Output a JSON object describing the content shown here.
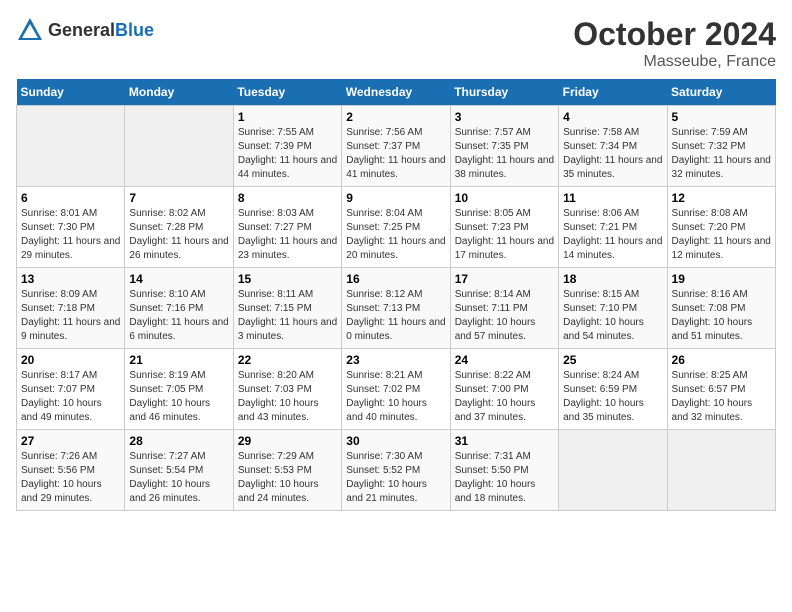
{
  "header": {
    "logo_general": "General",
    "logo_blue": "Blue",
    "month": "October 2024",
    "location": "Masseube, France"
  },
  "weekdays": [
    "Sunday",
    "Monday",
    "Tuesday",
    "Wednesday",
    "Thursday",
    "Friday",
    "Saturday"
  ],
  "weeks": [
    [
      {
        "day": "",
        "sunrise": "",
        "sunset": "",
        "daylight": ""
      },
      {
        "day": "",
        "sunrise": "",
        "sunset": "",
        "daylight": ""
      },
      {
        "day": "1",
        "sunrise": "Sunrise: 7:55 AM",
        "sunset": "Sunset: 7:39 PM",
        "daylight": "Daylight: 11 hours and 44 minutes."
      },
      {
        "day": "2",
        "sunrise": "Sunrise: 7:56 AM",
        "sunset": "Sunset: 7:37 PM",
        "daylight": "Daylight: 11 hours and 41 minutes."
      },
      {
        "day": "3",
        "sunrise": "Sunrise: 7:57 AM",
        "sunset": "Sunset: 7:35 PM",
        "daylight": "Daylight: 11 hours and 38 minutes."
      },
      {
        "day": "4",
        "sunrise": "Sunrise: 7:58 AM",
        "sunset": "Sunset: 7:34 PM",
        "daylight": "Daylight: 11 hours and 35 minutes."
      },
      {
        "day": "5",
        "sunrise": "Sunrise: 7:59 AM",
        "sunset": "Sunset: 7:32 PM",
        "daylight": "Daylight: 11 hours and 32 minutes."
      }
    ],
    [
      {
        "day": "6",
        "sunrise": "Sunrise: 8:01 AM",
        "sunset": "Sunset: 7:30 PM",
        "daylight": "Daylight: 11 hours and 29 minutes."
      },
      {
        "day": "7",
        "sunrise": "Sunrise: 8:02 AM",
        "sunset": "Sunset: 7:28 PM",
        "daylight": "Daylight: 11 hours and 26 minutes."
      },
      {
        "day": "8",
        "sunrise": "Sunrise: 8:03 AM",
        "sunset": "Sunset: 7:27 PM",
        "daylight": "Daylight: 11 hours and 23 minutes."
      },
      {
        "day": "9",
        "sunrise": "Sunrise: 8:04 AM",
        "sunset": "Sunset: 7:25 PM",
        "daylight": "Daylight: 11 hours and 20 minutes."
      },
      {
        "day": "10",
        "sunrise": "Sunrise: 8:05 AM",
        "sunset": "Sunset: 7:23 PM",
        "daylight": "Daylight: 11 hours and 17 minutes."
      },
      {
        "day": "11",
        "sunrise": "Sunrise: 8:06 AM",
        "sunset": "Sunset: 7:21 PM",
        "daylight": "Daylight: 11 hours and 14 minutes."
      },
      {
        "day": "12",
        "sunrise": "Sunrise: 8:08 AM",
        "sunset": "Sunset: 7:20 PM",
        "daylight": "Daylight: 11 hours and 12 minutes."
      }
    ],
    [
      {
        "day": "13",
        "sunrise": "Sunrise: 8:09 AM",
        "sunset": "Sunset: 7:18 PM",
        "daylight": "Daylight: 11 hours and 9 minutes."
      },
      {
        "day": "14",
        "sunrise": "Sunrise: 8:10 AM",
        "sunset": "Sunset: 7:16 PM",
        "daylight": "Daylight: 11 hours and 6 minutes."
      },
      {
        "day": "15",
        "sunrise": "Sunrise: 8:11 AM",
        "sunset": "Sunset: 7:15 PM",
        "daylight": "Daylight: 11 hours and 3 minutes."
      },
      {
        "day": "16",
        "sunrise": "Sunrise: 8:12 AM",
        "sunset": "Sunset: 7:13 PM",
        "daylight": "Daylight: 11 hours and 0 minutes."
      },
      {
        "day": "17",
        "sunrise": "Sunrise: 8:14 AM",
        "sunset": "Sunset: 7:11 PM",
        "daylight": "Daylight: 10 hours and 57 minutes."
      },
      {
        "day": "18",
        "sunrise": "Sunrise: 8:15 AM",
        "sunset": "Sunset: 7:10 PM",
        "daylight": "Daylight: 10 hours and 54 minutes."
      },
      {
        "day": "19",
        "sunrise": "Sunrise: 8:16 AM",
        "sunset": "Sunset: 7:08 PM",
        "daylight": "Daylight: 10 hours and 51 minutes."
      }
    ],
    [
      {
        "day": "20",
        "sunrise": "Sunrise: 8:17 AM",
        "sunset": "Sunset: 7:07 PM",
        "daylight": "Daylight: 10 hours and 49 minutes."
      },
      {
        "day": "21",
        "sunrise": "Sunrise: 8:19 AM",
        "sunset": "Sunset: 7:05 PM",
        "daylight": "Daylight: 10 hours and 46 minutes."
      },
      {
        "day": "22",
        "sunrise": "Sunrise: 8:20 AM",
        "sunset": "Sunset: 7:03 PM",
        "daylight": "Daylight: 10 hours and 43 minutes."
      },
      {
        "day": "23",
        "sunrise": "Sunrise: 8:21 AM",
        "sunset": "Sunset: 7:02 PM",
        "daylight": "Daylight: 10 hours and 40 minutes."
      },
      {
        "day": "24",
        "sunrise": "Sunrise: 8:22 AM",
        "sunset": "Sunset: 7:00 PM",
        "daylight": "Daylight: 10 hours and 37 minutes."
      },
      {
        "day": "25",
        "sunrise": "Sunrise: 8:24 AM",
        "sunset": "Sunset: 6:59 PM",
        "daylight": "Daylight: 10 hours and 35 minutes."
      },
      {
        "day": "26",
        "sunrise": "Sunrise: 8:25 AM",
        "sunset": "Sunset: 6:57 PM",
        "daylight": "Daylight: 10 hours and 32 minutes."
      }
    ],
    [
      {
        "day": "27",
        "sunrise": "Sunrise: 7:26 AM",
        "sunset": "Sunset: 5:56 PM",
        "daylight": "Daylight: 10 hours and 29 minutes."
      },
      {
        "day": "28",
        "sunrise": "Sunrise: 7:27 AM",
        "sunset": "Sunset: 5:54 PM",
        "daylight": "Daylight: 10 hours and 26 minutes."
      },
      {
        "day": "29",
        "sunrise": "Sunrise: 7:29 AM",
        "sunset": "Sunset: 5:53 PM",
        "daylight": "Daylight: 10 hours and 24 minutes."
      },
      {
        "day": "30",
        "sunrise": "Sunrise: 7:30 AM",
        "sunset": "Sunset: 5:52 PM",
        "daylight": "Daylight: 10 hours and 21 minutes."
      },
      {
        "day": "31",
        "sunrise": "Sunrise: 7:31 AM",
        "sunset": "Sunset: 5:50 PM",
        "daylight": "Daylight: 10 hours and 18 minutes."
      },
      {
        "day": "",
        "sunrise": "",
        "sunset": "",
        "daylight": ""
      },
      {
        "day": "",
        "sunrise": "",
        "sunset": "",
        "daylight": ""
      }
    ]
  ]
}
